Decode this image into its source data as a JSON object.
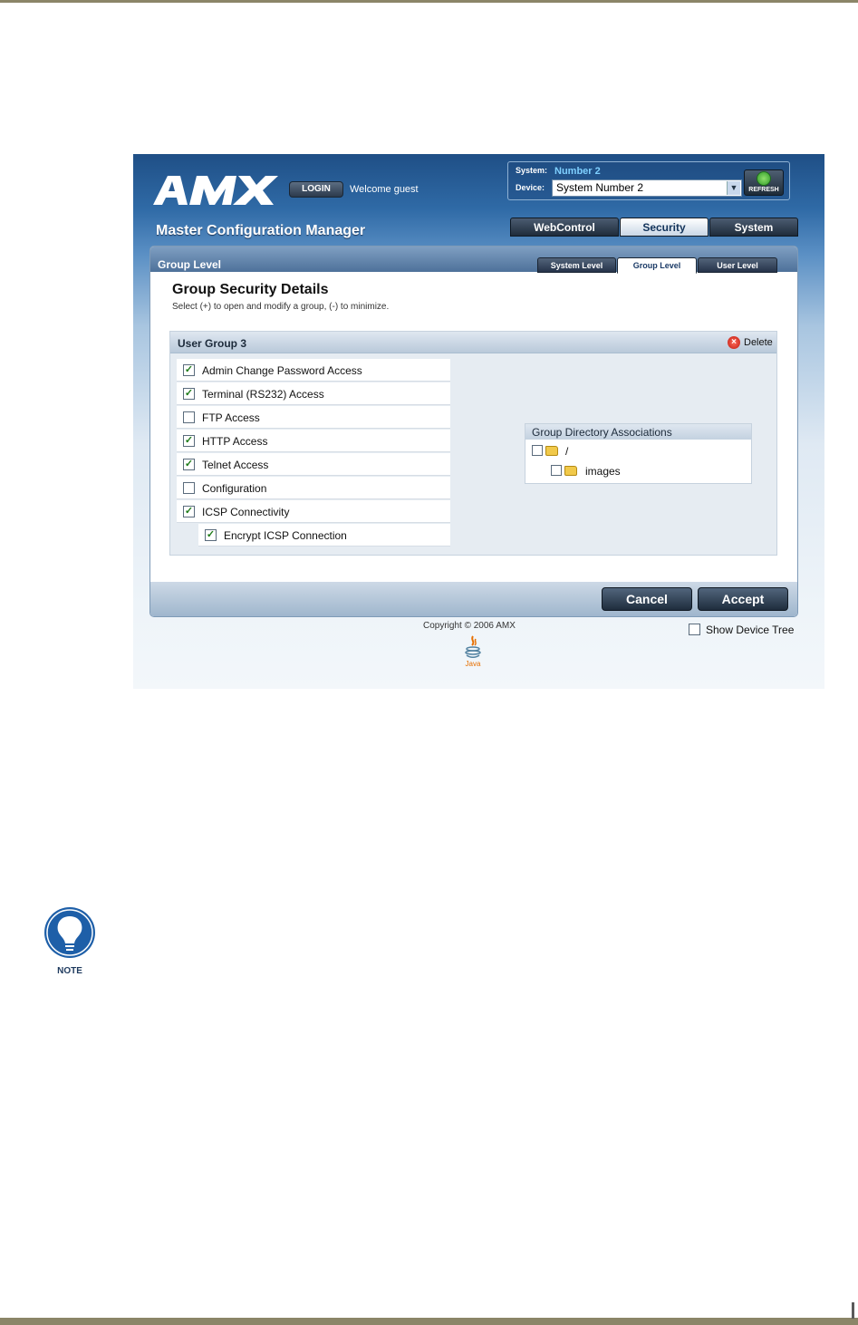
{
  "header": {
    "logo_text": "AMX",
    "login_label": "LOGIN",
    "welcome_text": "Welcome guest",
    "system_label": "System:",
    "system_value": "Number 2",
    "device_label": "Device:",
    "device_value": "System Number 2",
    "refresh_label": "REFRESH",
    "app_title": "Master Configuration Manager"
  },
  "main_tabs": [
    {
      "label": "WebControl",
      "active": false
    },
    {
      "label": "Security",
      "active": true
    },
    {
      "label": "System",
      "active": false
    }
  ],
  "panel": {
    "title": "Group Level",
    "sub_tabs": [
      {
        "label": "System Level",
        "active": false
      },
      {
        "label": "Group Level",
        "active": true
      },
      {
        "label": "User Level",
        "active": false
      }
    ],
    "details_title": "Group Security Details",
    "details_subtitle": "Select (+) to open and modify a group, (-) to minimize."
  },
  "user_group": {
    "title": "User Group 3",
    "delete_label": "Delete",
    "permissions": [
      {
        "label": "Admin Change Password Access",
        "checked": true
      },
      {
        "label": "Terminal (RS232) Access",
        "checked": true
      },
      {
        "label": "FTP Access",
        "checked": false
      },
      {
        "label": "HTTP Access",
        "checked": true
      },
      {
        "label": "Telnet Access",
        "checked": true
      },
      {
        "label": "Configuration",
        "checked": false
      },
      {
        "label": "ICSP Connectivity",
        "checked": true
      },
      {
        "label": "Encrypt ICSP Connection",
        "checked": true
      }
    ]
  },
  "directory": {
    "title": "Group Directory Associations",
    "items": [
      {
        "label": "/",
        "checked": false
      },
      {
        "label": "images",
        "checked": false
      }
    ]
  },
  "buttons": {
    "cancel_label": "Cancel",
    "accept_label": "Accept"
  },
  "footer": {
    "copyright": "Copyright © 2006 AMX",
    "show_device_tree_label": "Show Device Tree",
    "show_device_tree_checked": false,
    "java_label": "Java"
  },
  "note": {
    "label": "NOTE"
  },
  "colors": {
    "page_rule": "#8b8568",
    "header_blue": "#1f4f86",
    "system_value": "#7fd0ff",
    "check_green": "#1c7a16"
  }
}
